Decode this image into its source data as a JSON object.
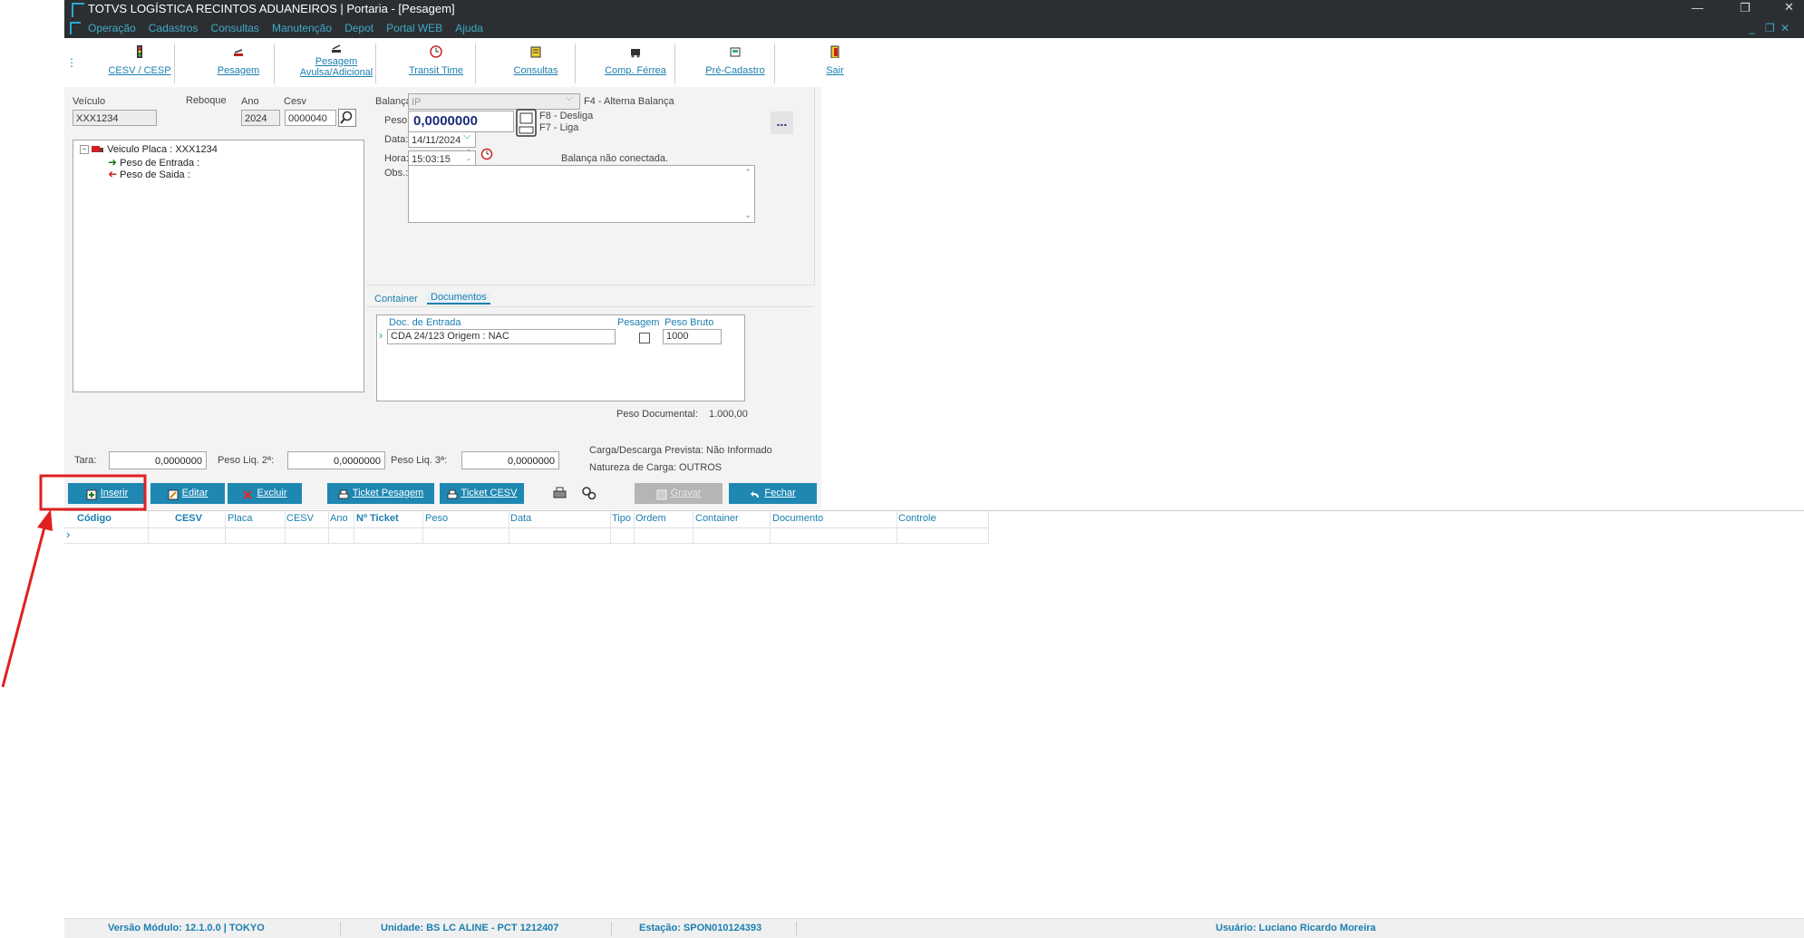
{
  "window": {
    "title": "TOTVS LOGÍSTICA RECINTOS ADUANEIROS | Portaria - [Pesagem]",
    "menu": [
      "Operação",
      "Cadastros",
      "Consultas",
      "Manutenção",
      "Depot",
      "Portal WEB",
      "Ajuda"
    ]
  },
  "toolbar": {
    "buttons": [
      {
        "label": "CESV / CESP",
        "icon": "traffic-light-icon"
      },
      {
        "label": "Pesagem",
        "icon": "scale-icon"
      },
      {
        "label1": "Pesagem",
        "label2": "Avulsa/Adicional",
        "icon": "scale-extra-icon"
      },
      {
        "label": "Transit Time",
        "icon": "clock-icon"
      },
      {
        "label": "Consultas",
        "icon": "consult-icon"
      },
      {
        "label": "Comp. Férrea",
        "icon": "train-icon"
      },
      {
        "label": "Pré-Cadastro",
        "icon": "pre-register-icon"
      },
      {
        "label": "Sair",
        "icon": "exit-door-icon"
      }
    ]
  },
  "form": {
    "veiculo_label": "Veículo",
    "veiculo_value": "XXX1234",
    "reboque_label": "Reboque",
    "ano_label": "Ano",
    "ano_value": "2024",
    "cesv_label": "Cesv",
    "cesv_value": "0000040",
    "balanca_label": "Balança:",
    "balanca_value": "IP",
    "balanca_hint": "F4 - Alterna Balança",
    "peso_label": "Peso:",
    "peso_value": "0,0000000",
    "f8_hint": "F8 - Desliga",
    "f7_hint": "F7 - Liga",
    "data_label": "Data:",
    "data_value": "14/11/2024",
    "hora_label": "Hora:",
    "hora_value": "15:03:15",
    "balanca_status": "Balança não conectada.",
    "obs_label": "Obs.:",
    "more_button": "..."
  },
  "tree": {
    "root": "Veiculo Placa : XXX1234",
    "entrada": "Peso de Entrada :",
    "saida": "Peso de Saida   :"
  },
  "tabs": {
    "container": "Container",
    "documentos": "Documentos"
  },
  "docs": {
    "headers": {
      "doc": "Doc. de Entrada",
      "pesagem": "Pesagem",
      "peso_bruto": "Peso Bruto"
    },
    "row": {
      "doc": "CDA 24/123   Origem : NAC",
      "peso_bruto": "1000"
    },
    "peso_documental_label": "Peso Documental:",
    "peso_documental_value": "1.000,00"
  },
  "totals": {
    "tara_label": "Tara:",
    "tara_value": "0,0000000",
    "liq2_label": "Peso Liq. 2ª:",
    "liq2_value": "0,0000000",
    "liq3_label": "Peso Liq. 3ª:",
    "liq3_value": "0,0000000",
    "carga_prevista": "Carga/Descarga Prevista: Não Informado",
    "natureza": "Natureza de Carga: OUTROS"
  },
  "actions": {
    "inserir": "Inserir",
    "editar": "Editar",
    "excluir": "Excluir",
    "ticket_pesagem": "Ticket Pesagem",
    "ticket_cesv": "Ticket CESV",
    "gravar": "Gravar",
    "fechar": "Fechar"
  },
  "grid": {
    "columns": [
      "Código",
      "CESV",
      "Placa",
      "CESV",
      "Ano",
      "Nº Ticket",
      "Peso",
      "Data",
      "Tipo",
      "Ordem",
      "Container",
      "Documento",
      "Controle"
    ]
  },
  "status": {
    "versao": "Versão Módulo:  12.1.0.0  |  TOKYO",
    "unidade": "Unidade:  BS LC ALINE - PCT 1212407",
    "estacao": "Estação:  SPON010124393",
    "usuario": "Usuário:  Luciano Ricardo Moreira"
  },
  "colors": {
    "accent": "#1e87b2",
    "titlebar": "#2b2f31",
    "annotation": "#e02020"
  }
}
